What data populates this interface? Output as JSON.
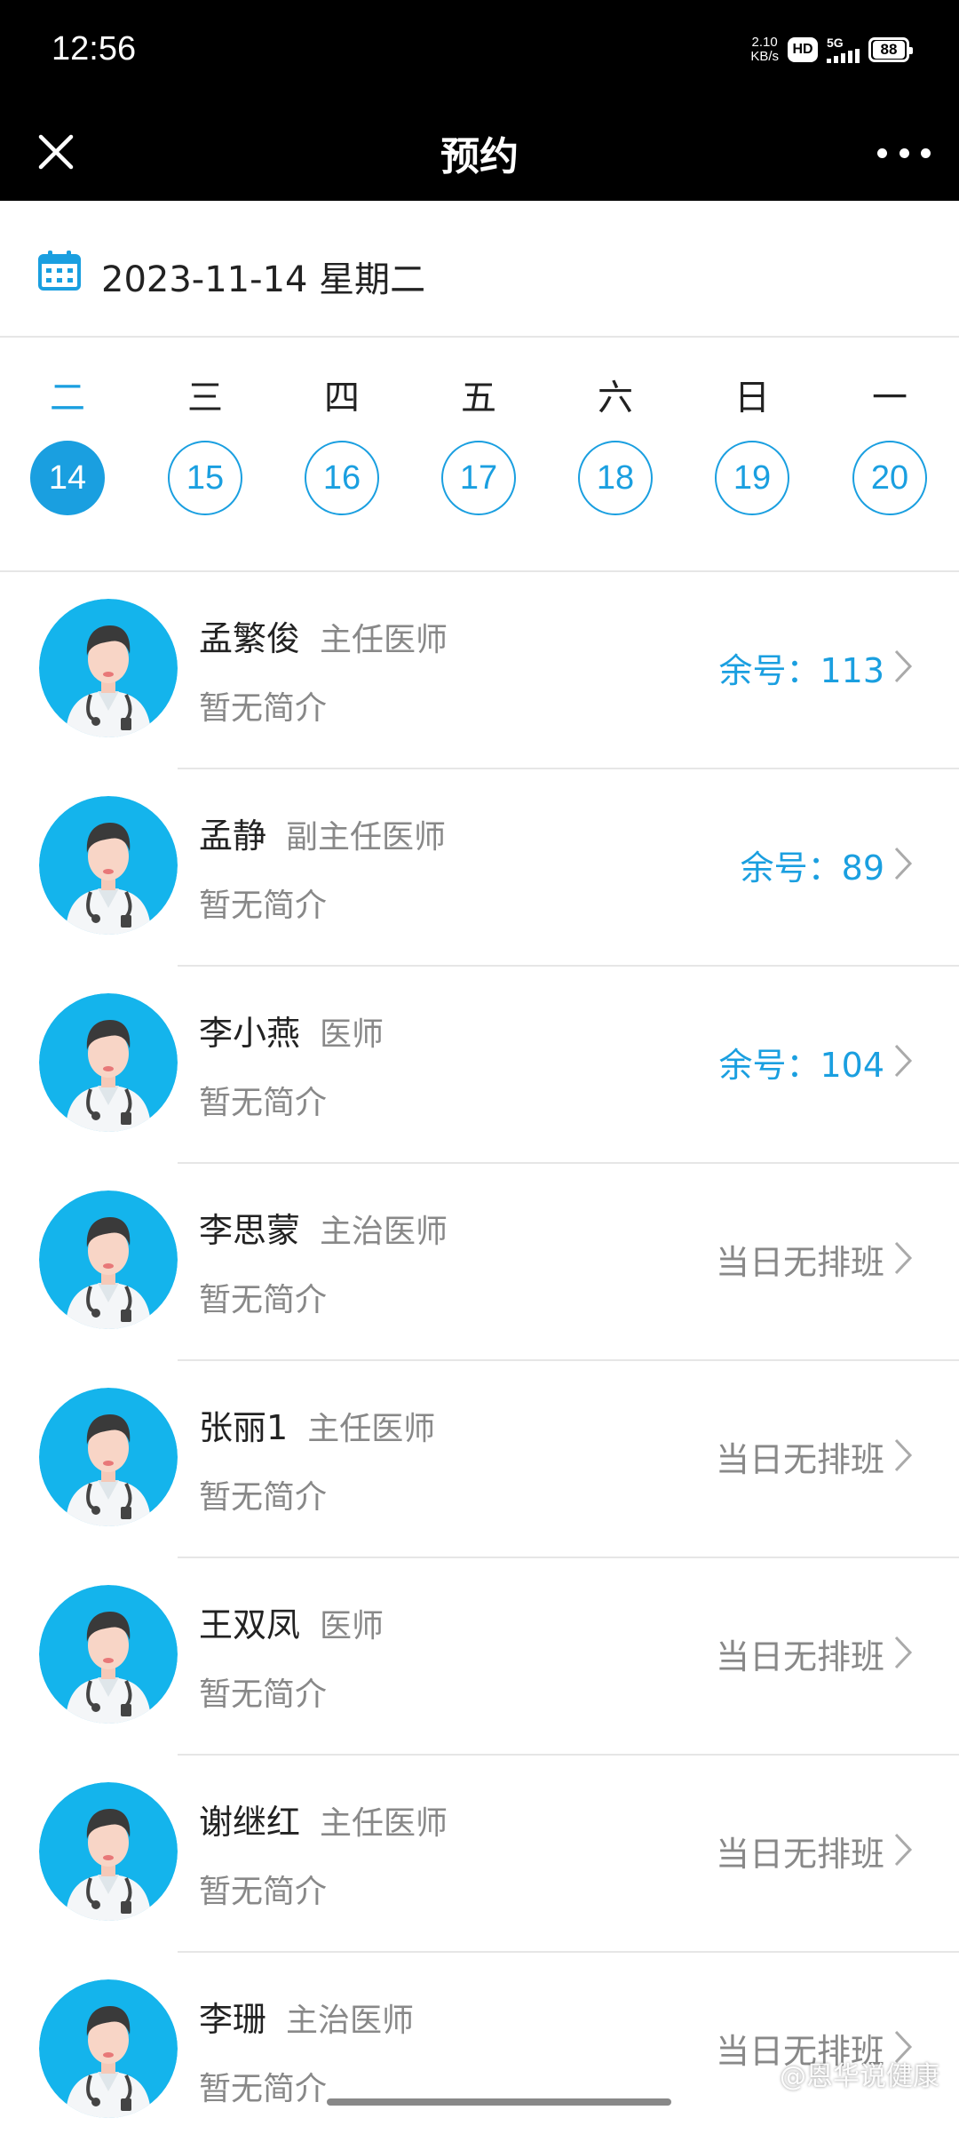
{
  "status_bar": {
    "time": "12:56",
    "speed_value": "2.10",
    "speed_unit": "KB/s",
    "hd_badge": "HD",
    "network": "5G",
    "battery": "88"
  },
  "navbar": {
    "title": "预约",
    "close_icon": "close-icon",
    "more_icon": "more-icon"
  },
  "date_bar": {
    "date_text": "2023-11-14 星期二",
    "icon": "calendar-icon"
  },
  "week": {
    "days": [
      {
        "weekday": "二",
        "date": "14",
        "selected": true
      },
      {
        "weekday": "三",
        "date": "15",
        "selected": false
      },
      {
        "weekday": "四",
        "date": "16",
        "selected": false
      },
      {
        "weekday": "五",
        "date": "17",
        "selected": false
      },
      {
        "weekday": "六",
        "date": "18",
        "selected": false
      },
      {
        "weekday": "日",
        "date": "19",
        "selected": false
      },
      {
        "weekday": "一",
        "date": "20",
        "selected": false
      }
    ]
  },
  "doctors": [
    {
      "name": "孟繁俊",
      "title": "主任医师",
      "intro": "暂无简介",
      "status": "余号：113",
      "available": true
    },
    {
      "name": "孟静",
      "title": "副主任医师",
      "intro": "暂无简介",
      "status": "余号：89",
      "available": true
    },
    {
      "name": "李小燕",
      "title": "医师",
      "intro": "暂无简介",
      "status": "余号：104",
      "available": true
    },
    {
      "name": "李思蒙",
      "title": "主治医师",
      "intro": "暂无简介",
      "status": "当日无排班",
      "available": false
    },
    {
      "name": "张丽1",
      "title": "主任医师",
      "intro": "暂无简介",
      "status": "当日无排班",
      "available": false
    },
    {
      "name": "王双凤",
      "title": "医师",
      "intro": "暂无简介",
      "status": "当日无排班",
      "available": false
    },
    {
      "name": "谢继红",
      "title": "主任医师",
      "intro": "暂无简介",
      "status": "当日无排班",
      "available": false
    },
    {
      "name": "李珊",
      "title": "主治医师",
      "intro": "暂无简介",
      "status": "当日无排班",
      "available": false
    }
  ],
  "watermark": "@恩华说健康",
  "colors": {
    "accent": "#1a9fe0",
    "avatar_bg": "#14b4ec",
    "muted_text": "#888888",
    "primary_text": "#222222"
  }
}
